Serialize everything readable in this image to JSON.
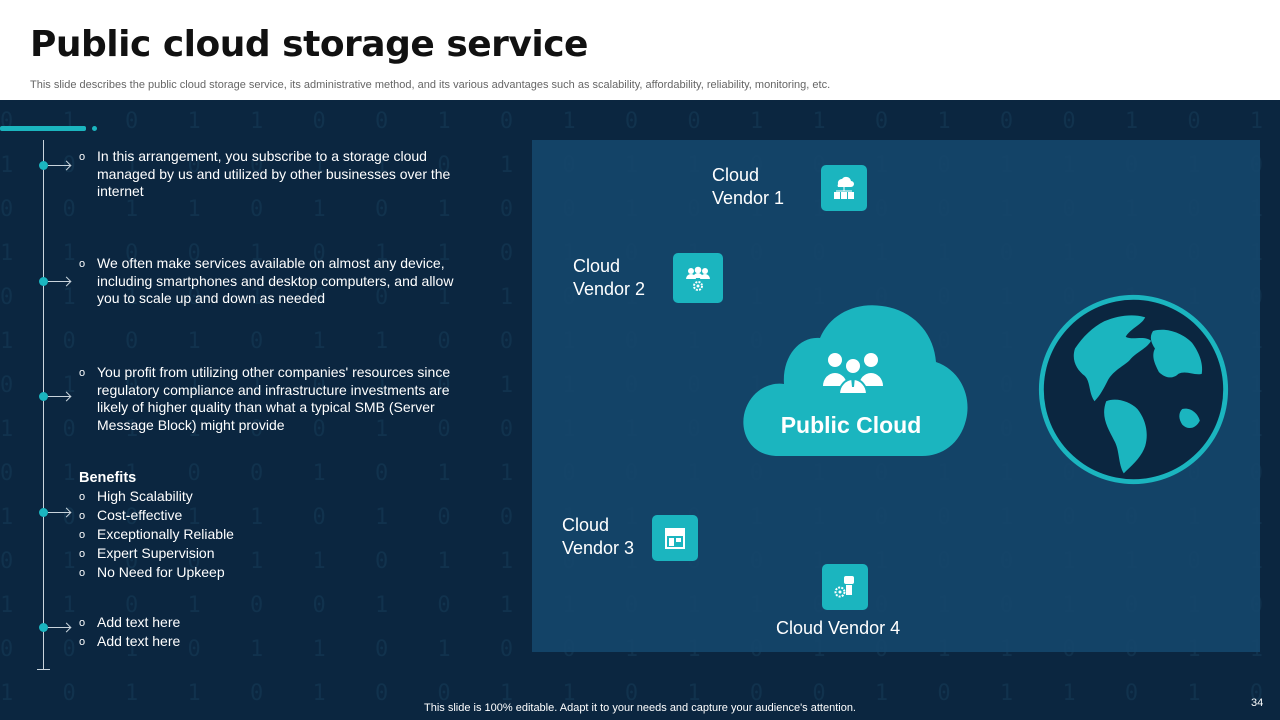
{
  "header": {
    "title": "Public cloud storage service",
    "subtitle": "This slide describes the public cloud storage service, its administrative method, and its various advantages such as scalability, affordability, reliability, monitoring, etc."
  },
  "points": [
    "In this arrangement, you subscribe to a storage cloud managed by us and utilized by other businesses over the internet",
    "We often make services available on almost any device, including smartphones and desktop computers, and allow you to scale up and down as needed",
    "You profit from utilizing other companies' resources since regulatory compliance and infrastructure investments are likely of higher quality than what a typical SMB (Server Message Block) might provide"
  ],
  "benefits": {
    "title": "Benefits",
    "items": [
      "High Scalability",
      "Cost-effective",
      "Exceptionally Reliable",
      "Expert Supervision",
      "No Need for Upkeep"
    ]
  },
  "extra_items": [
    "Add text here",
    "Add text here"
  ],
  "bullet_glyph": "o",
  "diagram": {
    "center_label": "Public Cloud",
    "vendors": [
      {
        "line1": "Cloud",
        "line2": "Vendor 1",
        "icon": "cloud-network-icon"
      },
      {
        "line1": "Cloud",
        "line2": "Vendor 2",
        "icon": "team-gear-icon"
      },
      {
        "line1": "Cloud",
        "line2": "Vendor 3",
        "icon": "storefront-icon"
      },
      {
        "line1": "Cloud Vendor 4",
        "line2": "",
        "icon": "robot-gear-icon"
      }
    ]
  },
  "footer": "This slide is 100% editable. Adapt it to your needs and capture your audience's attention.",
  "page_number": "34",
  "colors": {
    "accent": "#1bb5bf",
    "background": "#0b2640",
    "panel": "#15456a"
  }
}
